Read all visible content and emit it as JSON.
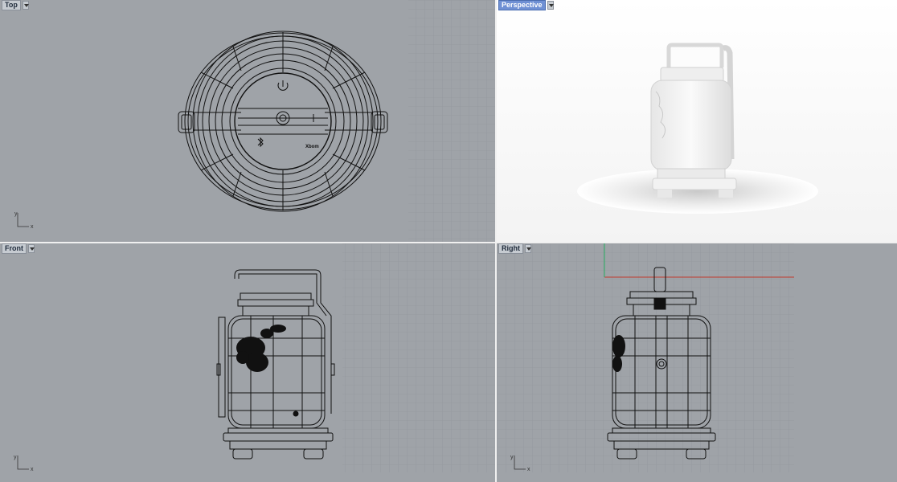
{
  "viewports": {
    "top": {
      "label": "Top"
    },
    "perspective": {
      "label": "Perspective"
    },
    "front": {
      "label": "Front"
    },
    "right": {
      "label": "Right"
    }
  },
  "axis_labels": {
    "y": "y",
    "x": "x"
  },
  "model_text": {
    "brand": "Xbom"
  },
  "colors": {
    "viewport_bg": "#9fa3a8",
    "grid_line": "#8c9096",
    "active_tab": "#6f90d4",
    "x_axis": "#c0392b",
    "y_axis": "#27ae60"
  }
}
